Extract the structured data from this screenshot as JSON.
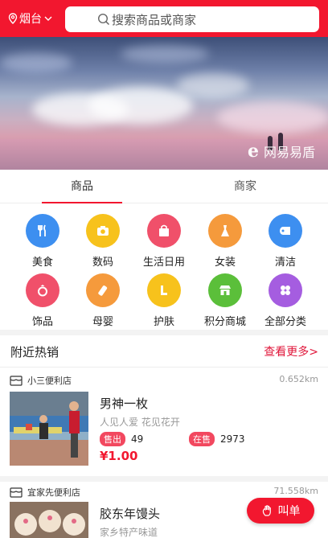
{
  "header": {
    "city": "烟台",
    "search_placeholder": "搜索商品或商家",
    "color": "#f2172f"
  },
  "banner": {
    "watermark": "网易易盾",
    "watermark_icon": "e-logo-icon"
  },
  "tabs": [
    {
      "label": "商品",
      "active": true
    },
    {
      "label": "商家",
      "active": false
    }
  ],
  "categories": [
    {
      "label": "美食",
      "icon": "cutlery-icon",
      "color": "#3d8ff0"
    },
    {
      "label": "数码",
      "icon": "camera-icon",
      "color": "#f7c21c"
    },
    {
      "label": "生活日用",
      "icon": "shopping-bag-icon",
      "color": "#f0506a"
    },
    {
      "label": "女装",
      "icon": "dress-icon",
      "color": "#f59a3c"
    },
    {
      "label": "清洁",
      "icon": "tissue-roll-icon",
      "color": "#3d8ff0"
    },
    {
      "label": "饰品",
      "icon": "ring-icon",
      "color": "#f0506a"
    },
    {
      "label": "母婴",
      "icon": "baby-bottle-icon",
      "color": "#f59a3c"
    },
    {
      "label": "护肤",
      "icon": "boots-icon",
      "color": "#f7c21c"
    },
    {
      "label": "积分商城",
      "icon": "store-icon",
      "color": "#5bbf3a"
    },
    {
      "label": "全部分类",
      "icon": "grid-four-icon",
      "color": "#a55de0"
    }
  ],
  "nearby": {
    "title": "附近热销",
    "more": "查看更多>"
  },
  "shops": [
    {
      "name": "小三便利店",
      "distance": "0.652km",
      "product": "男神一枚",
      "desc": "人见人爱 花见花开",
      "sold_label": "售出",
      "sold": "49",
      "onsale_label": "在售",
      "onsale": "2973",
      "price": "¥1.00"
    },
    {
      "name": "宜家先便利店",
      "distance": "71.558km",
      "product": "胶东年馒头",
      "desc": "家乡特产味道"
    }
  ],
  "fab": {
    "label": "叫单",
    "icon": "hand-icon"
  }
}
